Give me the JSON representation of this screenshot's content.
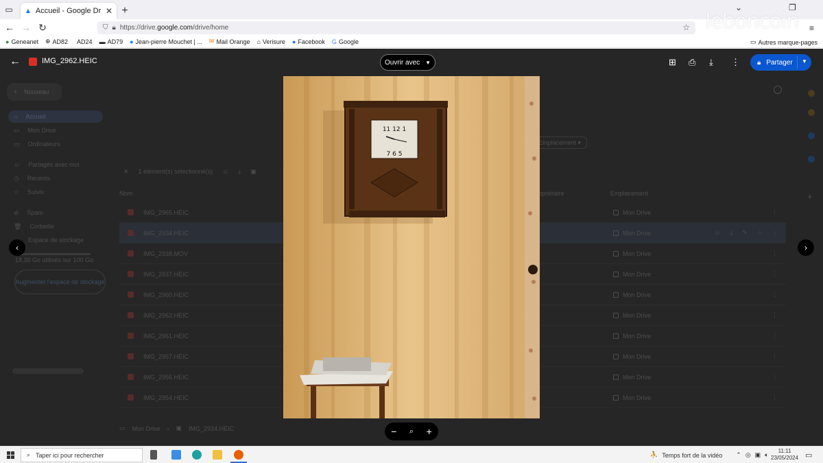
{
  "browser": {
    "tab_title": "Accueil - Google Drive",
    "url_prefix": "https://drive.",
    "url_domain": "google.com",
    "url_path": "/drive/home",
    "bookmarks": [
      "Geneanet",
      "AD82",
      "AD24",
      "AD79",
      "Jean-pierre Mouchet | ...",
      "Mail Orange",
      "Verisure",
      "Facebook",
      "Google"
    ],
    "other_bookmarks": "Autres marque-pages"
  },
  "watermark": "leboncoin",
  "viewer": {
    "file_name": "IMG_2962.HEIC",
    "open_with": "Ouvrir avec",
    "share": "Partager"
  },
  "drive": {
    "new_label": "Nouveau",
    "sidebar": [
      "Accueil",
      "Mon Drive",
      "Ordinateurs",
      "Partagés avec moi",
      "Récents",
      "Suivis",
      "Spam",
      "Corbeille",
      "Espace de stockage"
    ],
    "storage_text": "18,36 Go utilisés sur 100 Go",
    "buy_storage": "Augmenter l'espace de stockage",
    "selection": "1 élément(s) sélectionné(s)",
    "location_filter": "Emplacement",
    "col_name": "Nom",
    "col_owner": "Propriétaire",
    "col_location": "Emplacement",
    "files": [
      "IMG_2965.HEIC",
      "IMG_2934.HEIC",
      "IMG_2938.MOV",
      "IMG_2937.HEIC",
      "IMG_2960.HEIC",
      "IMG_2962.HEIC",
      "IMG_2961.HEIC",
      "IMG_2957.HEIC",
      "IMG_2956.HEIC",
      "IMG_2954.HEIC"
    ],
    "file_location": "Mon Drive",
    "breadcrumb_root": "Mon Drive",
    "breadcrumb_file": "IMG_2934.HEIC"
  },
  "taskbar": {
    "search_placeholder": "Taper ici pour rechercher",
    "news": "Temps fort de la vidéo",
    "time": "11:11",
    "date": "23/05/2024"
  }
}
